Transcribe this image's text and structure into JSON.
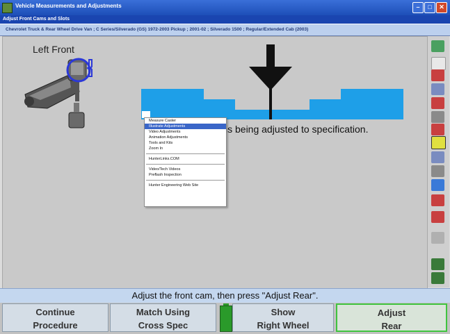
{
  "window": {
    "title": "Vehicle Measurements and Adjustments"
  },
  "section_title": "Adjust Front Cams and Slots",
  "vehicle_description": "Chevrolet Truck & Rear Wheel Drive Van ; C Series/Silverado (GS) 1972-2003 Pickup ; 2001-02 ; Silverado 1500 ; Regular/Extended Cab (2003)",
  "wheel_label": "Left Front",
  "status_message": "is being adjusted to specification.",
  "instruction": "Adjust the front cam, then press \"Adjust Rear\".",
  "context_menu": {
    "items": [
      {
        "label": "Measure Caster",
        "highlighted": false
      },
      {
        "label": "Illustrate Adjustments",
        "highlighted": true
      },
      {
        "label": "Video Adjustments",
        "highlighted": false
      },
      {
        "label": "Animation Adjustments",
        "highlighted": false
      },
      {
        "label": "Tools and Kits",
        "highlighted": false
      },
      {
        "label": "Zoom In",
        "highlighted": false
      },
      {
        "separator": true
      },
      {
        "label": "HunterLinks.COM",
        "highlighted": false
      },
      {
        "separator": true
      },
      {
        "label": "Video/Tech Videos",
        "highlighted": false
      },
      {
        "label": "Preflash Inspection",
        "highlighted": false
      },
      {
        "separator": true
      },
      {
        "label": "Hunter Engineering Web Site",
        "highlighted": false
      }
    ]
  },
  "buttons": {
    "continue": {
      "line1": "Continue",
      "line2": "Procedure"
    },
    "match": {
      "line1": "Match Using",
      "line2": "Cross Spec"
    },
    "show": {
      "line1": "Show",
      "line2": "Right Wheel"
    },
    "adjust": {
      "line1": "Adjust",
      "line2": "Rear"
    }
  },
  "meter": {
    "value": 0.5
  },
  "colors": {
    "meter_blue": "#1e9fe8",
    "titlebar": "#1d4fb8",
    "active_border": "#3fc43f",
    "highlight": "#3a66c8"
  }
}
